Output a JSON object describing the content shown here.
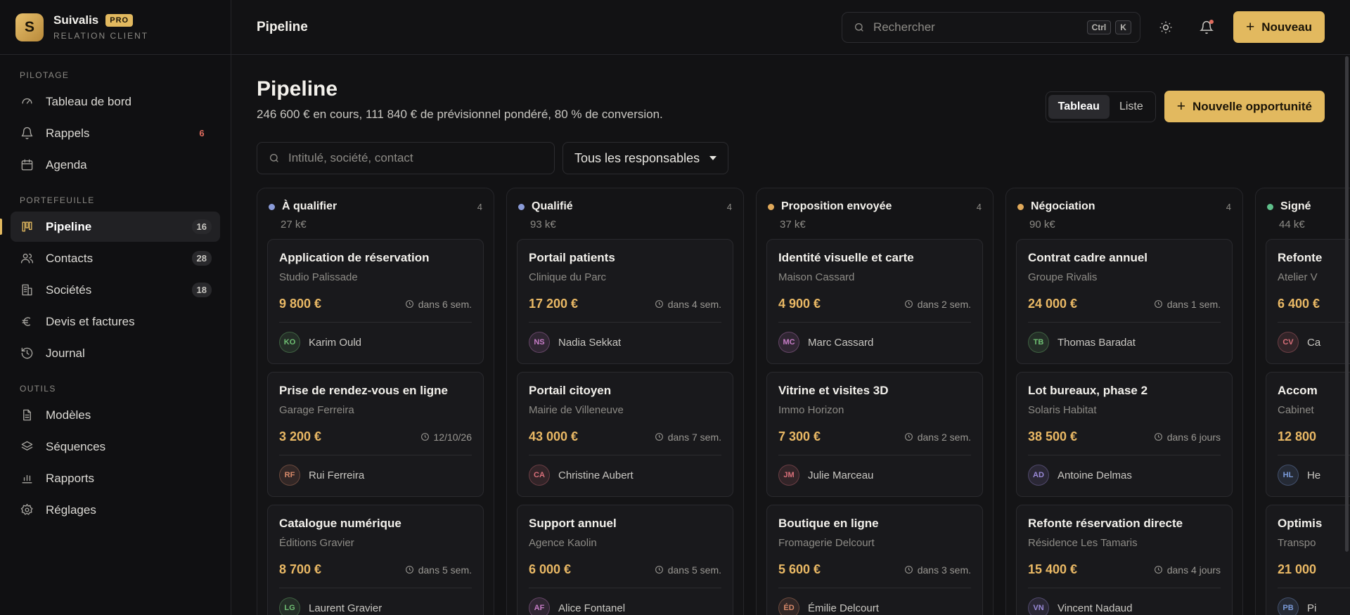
{
  "brand": {
    "name": "Suivalis",
    "badge": "PRO",
    "subtitle": "RELATION CLIENT",
    "logo_letter": "S"
  },
  "sidebar": {
    "sections": [
      {
        "title": "PILOTAGE",
        "items": [
          {
            "label": "Tableau de bord",
            "icon": "gauge-icon"
          },
          {
            "label": "Rappels",
            "icon": "bell-icon",
            "badge": "6",
            "badge_color": "#e06c5e"
          },
          {
            "label": "Agenda",
            "icon": "calendar-icon"
          }
        ]
      },
      {
        "title": "PORTEFEUILLE",
        "items": [
          {
            "label": "Pipeline",
            "icon": "kanban-icon",
            "badge": "16",
            "active": true
          },
          {
            "label": "Contacts",
            "icon": "users-icon",
            "badge": "28"
          },
          {
            "label": "Sociétés",
            "icon": "building-icon",
            "badge": "18"
          },
          {
            "label": "Devis et factures",
            "icon": "euro-icon"
          },
          {
            "label": "Journal",
            "icon": "history-icon"
          }
        ]
      },
      {
        "title": "OUTILS",
        "items": [
          {
            "label": "Modèles",
            "icon": "file-icon"
          },
          {
            "label": "Séquences",
            "icon": "layers-icon"
          },
          {
            "label": "Rapports",
            "icon": "bar-chart-icon"
          },
          {
            "label": "Réglages",
            "icon": "gear-icon"
          }
        ]
      }
    ]
  },
  "topbar": {
    "title": "Pipeline",
    "search_placeholder": "Rechercher",
    "shortcut": [
      "Ctrl",
      "K"
    ],
    "new_button": "Nouveau"
  },
  "header": {
    "title": "Pipeline",
    "subtitle": "246 600 € en cours, 111 840 € de prévisionnel pondéré, 80 % de conversion.",
    "views": [
      "Tableau",
      "Liste"
    ],
    "active_view": "Tableau",
    "new_opportunity": "Nouvelle opportunité"
  },
  "filters": {
    "search_placeholder": "Intitulé, société, contact",
    "owner_select": "Tous les responsables"
  },
  "colors": {
    "accent": "#e2b95f",
    "amount": "#eab965"
  },
  "columns": [
    {
      "name": "À qualifier",
      "count": "4",
      "sum": "27 k€",
      "dot": "#8a9bd8",
      "cards": [
        {
          "title": "Application de réservation",
          "company": "Studio Palissade",
          "amount": "9 800 €",
          "due": "dans 6 sem.",
          "initials": "KO",
          "owner": "Karim Ould",
          "av": "#6fbf73"
        },
        {
          "title": "Prise de rendez-vous en ligne",
          "company": "Garage Ferreira",
          "amount": "3 200 €",
          "due": "12/10/26",
          "initials": "RF",
          "owner": "Rui Ferreira",
          "av": "#d98a6a"
        },
        {
          "title": "Catalogue numérique",
          "company": "Éditions Gravier",
          "amount": "8 700 €",
          "due": "dans 5 sem.",
          "initials": "LG",
          "owner": "Laurent Gravier",
          "av": "#6fbf73"
        }
      ]
    },
    {
      "name": "Qualifié",
      "count": "4",
      "sum": "93 k€",
      "dot": "#8a9bd8",
      "cards": [
        {
          "title": "Portail patients",
          "company": "Clinique du Parc",
          "amount": "17 200 €",
          "due": "dans 4 sem.",
          "initials": "NS",
          "owner": "Nadia Sekkat",
          "av": "#c77dc7"
        },
        {
          "title": "Portail citoyen",
          "company": "Mairie de Villeneuve",
          "amount": "43 000 €",
          "due": "dans 7 sem.",
          "initials": "CA",
          "owner": "Christine Aubert",
          "av": "#d9707a"
        },
        {
          "title": "Support annuel",
          "company": "Agence Kaolin",
          "amount": "6 000 €",
          "due": "dans 5 sem.",
          "initials": "AF",
          "owner": "Alice Fontanel",
          "av": "#c77dc7"
        }
      ]
    },
    {
      "name": "Proposition envoyée",
      "count": "4",
      "sum": "37 k€",
      "dot": "#e0a95a",
      "cards": [
        {
          "title": "Identité visuelle et carte",
          "company": "Maison Cassard",
          "amount": "4 900 €",
          "due": "dans 2 sem.",
          "initials": "MC",
          "owner": "Marc Cassard",
          "av": "#c77dc7"
        },
        {
          "title": "Vitrine et visites 3D",
          "company": "Immo Horizon",
          "amount": "7 300 €",
          "due": "dans 2 sem.",
          "initials": "JM",
          "owner": "Julie Marceau",
          "av": "#d9707a"
        },
        {
          "title": "Boutique en ligne",
          "company": "Fromagerie Delcourt",
          "amount": "5 600 €",
          "due": "dans 3 sem.",
          "initials": "ÉD",
          "owner": "Émilie Delcourt",
          "av": "#d98a6a"
        }
      ]
    },
    {
      "name": "Négociation",
      "count": "4",
      "sum": "90 k€",
      "dot": "#e0a95a",
      "cards": [
        {
          "title": "Contrat cadre annuel",
          "company": "Groupe Rivalis",
          "amount": "24 000 €",
          "due": "dans 1 sem.",
          "initials": "TB",
          "owner": "Thomas Baradat",
          "av": "#6fbf73"
        },
        {
          "title": "Lot bureaux, phase 2",
          "company": "Solaris Habitat",
          "amount": "38 500 €",
          "due": "dans 6 jours",
          "initials": "AD",
          "owner": "Antoine Delmas",
          "av": "#9a8ad8"
        },
        {
          "title": "Refonte réservation directe",
          "company": "Résidence Les Tamaris",
          "amount": "15 400 €",
          "due": "dans 4 jours",
          "initials": "VN",
          "owner": "Vincent Nadaud",
          "av": "#9a8ad8"
        }
      ]
    },
    {
      "name": "Signé",
      "count": "",
      "sum": "44 k€",
      "dot": "#5fbf8a",
      "cards": [
        {
          "title": "Refonte",
          "company": "Atelier V",
          "amount": "6 400 €",
          "due": "",
          "initials": "CV",
          "owner": "Ca",
          "av": "#d9707a"
        },
        {
          "title": "Accom",
          "company": "Cabinet",
          "amount": "12 800",
          "due": "",
          "initials": "HL",
          "owner": "He",
          "av": "#7a9ad8"
        },
        {
          "title": "Optimis",
          "company": "Transpo",
          "amount": "21 000",
          "due": "",
          "initials": "PB",
          "owner": "Pi",
          "av": "#7a9ad8"
        }
      ]
    }
  ]
}
